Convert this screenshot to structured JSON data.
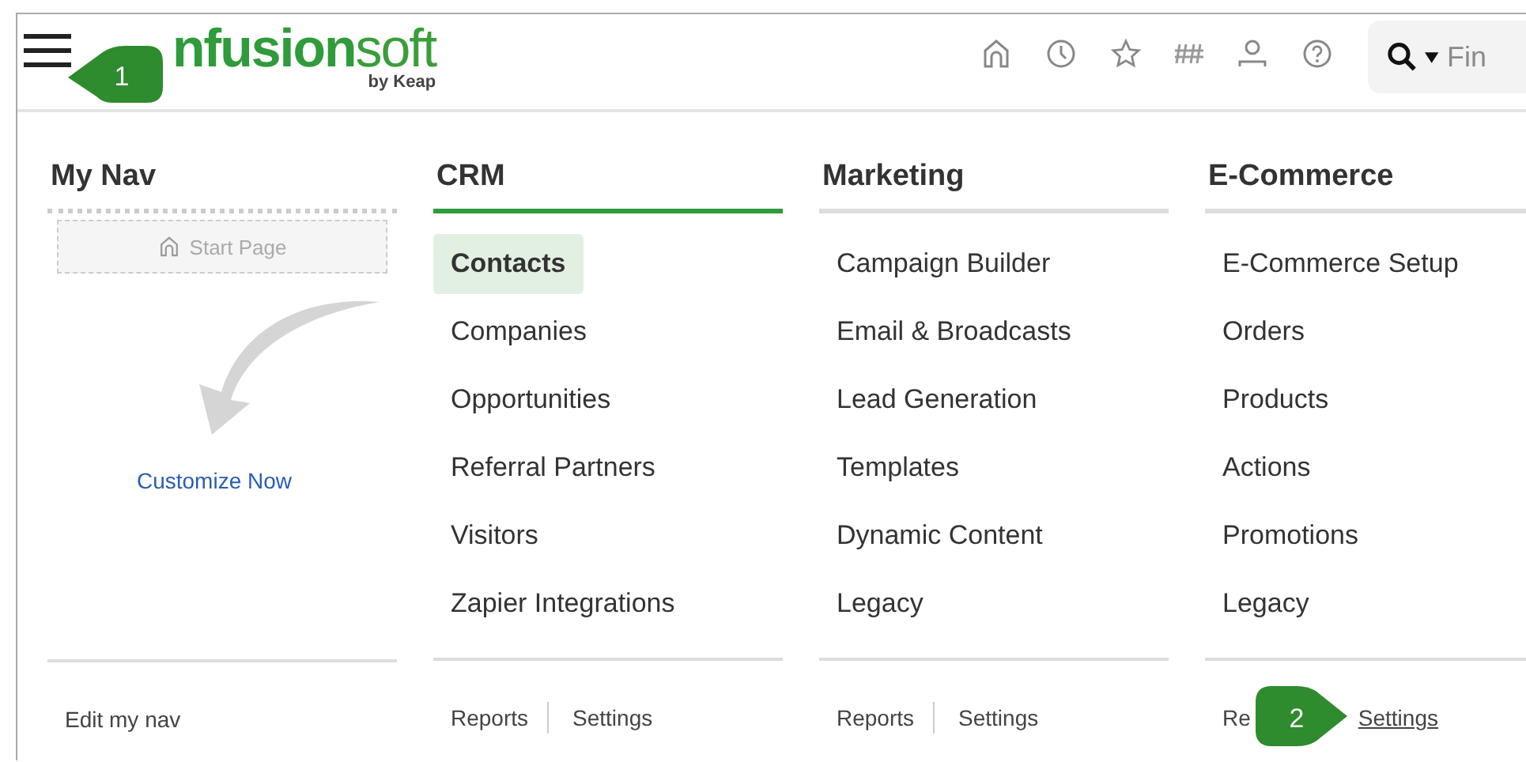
{
  "header": {
    "logo": {
      "text": "**nfusion**soft",
      "byline": "by Keap"
    },
    "search": {
      "placeholder": "Fin"
    }
  },
  "my_nav": {
    "title": "My Nav",
    "start_page": "Start Page",
    "customize": "Customize Now",
    "footer": "Edit my nav"
  },
  "columns": [
    {
      "title": "CRM",
      "selected": true,
      "items": [
        {
          "label": "Contacts",
          "selected": true
        },
        {
          "label": "Companies",
          "selected": false
        },
        {
          "label": "Opportunities",
          "selected": false
        },
        {
          "label": "Referral Partners",
          "selected": false
        },
        {
          "label": "Visitors",
          "selected": false
        },
        {
          "label": "Zapier Integrations",
          "selected": false
        }
      ],
      "footer": [
        {
          "label": "Reports",
          "underlined": false
        },
        {
          "label": "Settings",
          "underlined": false
        }
      ]
    },
    {
      "title": "Marketing",
      "selected": false,
      "items": [
        {
          "label": "Campaign Builder",
          "selected": false
        },
        {
          "label": "Email & Broadcasts",
          "selected": false
        },
        {
          "label": "Lead Generation",
          "selected": false
        },
        {
          "label": "Templates",
          "selected": false
        },
        {
          "label": "Dynamic Content",
          "selected": false
        },
        {
          "label": "Legacy",
          "selected": false
        }
      ],
      "footer": [
        {
          "label": "Reports",
          "underlined": false
        },
        {
          "label": "Settings",
          "underlined": false
        }
      ]
    },
    {
      "title": "E-Commerce",
      "selected": false,
      "items": [
        {
          "label": "E-Commerce Setup",
          "selected": false
        },
        {
          "label": "Orders",
          "selected": false
        },
        {
          "label": "Products",
          "selected": false
        },
        {
          "label": "Actions",
          "selected": false
        },
        {
          "label": "Promotions",
          "selected": false
        },
        {
          "label": "Legacy",
          "selected": false
        }
      ],
      "footer": [
        {
          "label": "Re",
          "underlined": false
        },
        {
          "label": "Settings",
          "underlined": true
        }
      ]
    }
  ],
  "callouts": [
    {
      "label": "1",
      "kind": "left"
    },
    {
      "label": "2",
      "kind": "right"
    }
  ]
}
